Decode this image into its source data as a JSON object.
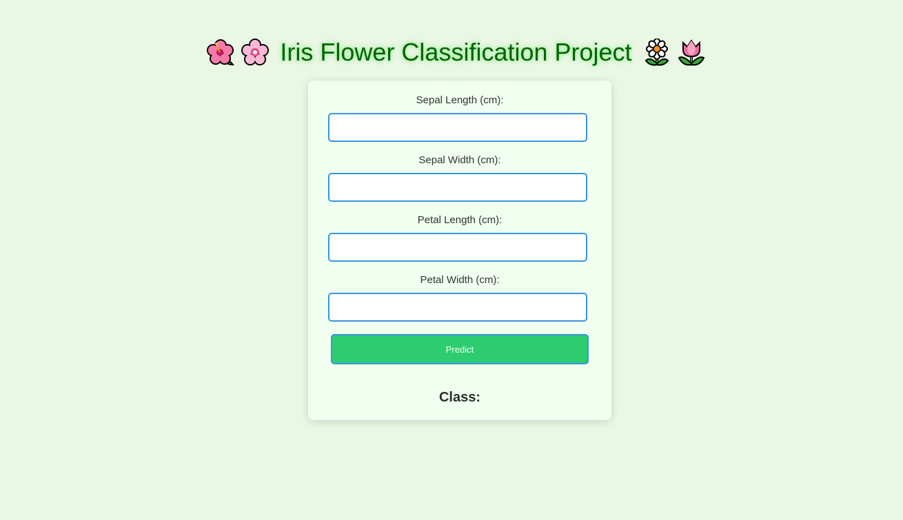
{
  "header": {
    "title": "Iris Flower Classification Project",
    "icons_left": [
      "hibiscus-icon",
      "cherry-blossom-icon"
    ],
    "icons_right": [
      "blossom-icon",
      "tulip-icon"
    ]
  },
  "form": {
    "fields": [
      {
        "label": "Sepal Length (cm):",
        "value": "",
        "placeholder": ""
      },
      {
        "label": "Sepal Width (cm):",
        "value": "",
        "placeholder": ""
      },
      {
        "label": "Petal Length (cm):",
        "value": "",
        "placeholder": ""
      },
      {
        "label": "Petal Width (cm):",
        "value": "",
        "placeholder": ""
      }
    ],
    "submit_label": "Predict"
  },
  "result": {
    "label": "Class:"
  },
  "colors": {
    "background": "#eaf7e4",
    "card": "#f0fff0",
    "title": "#006400",
    "input_border": "#3a95dc",
    "button": "#2ecc71"
  }
}
